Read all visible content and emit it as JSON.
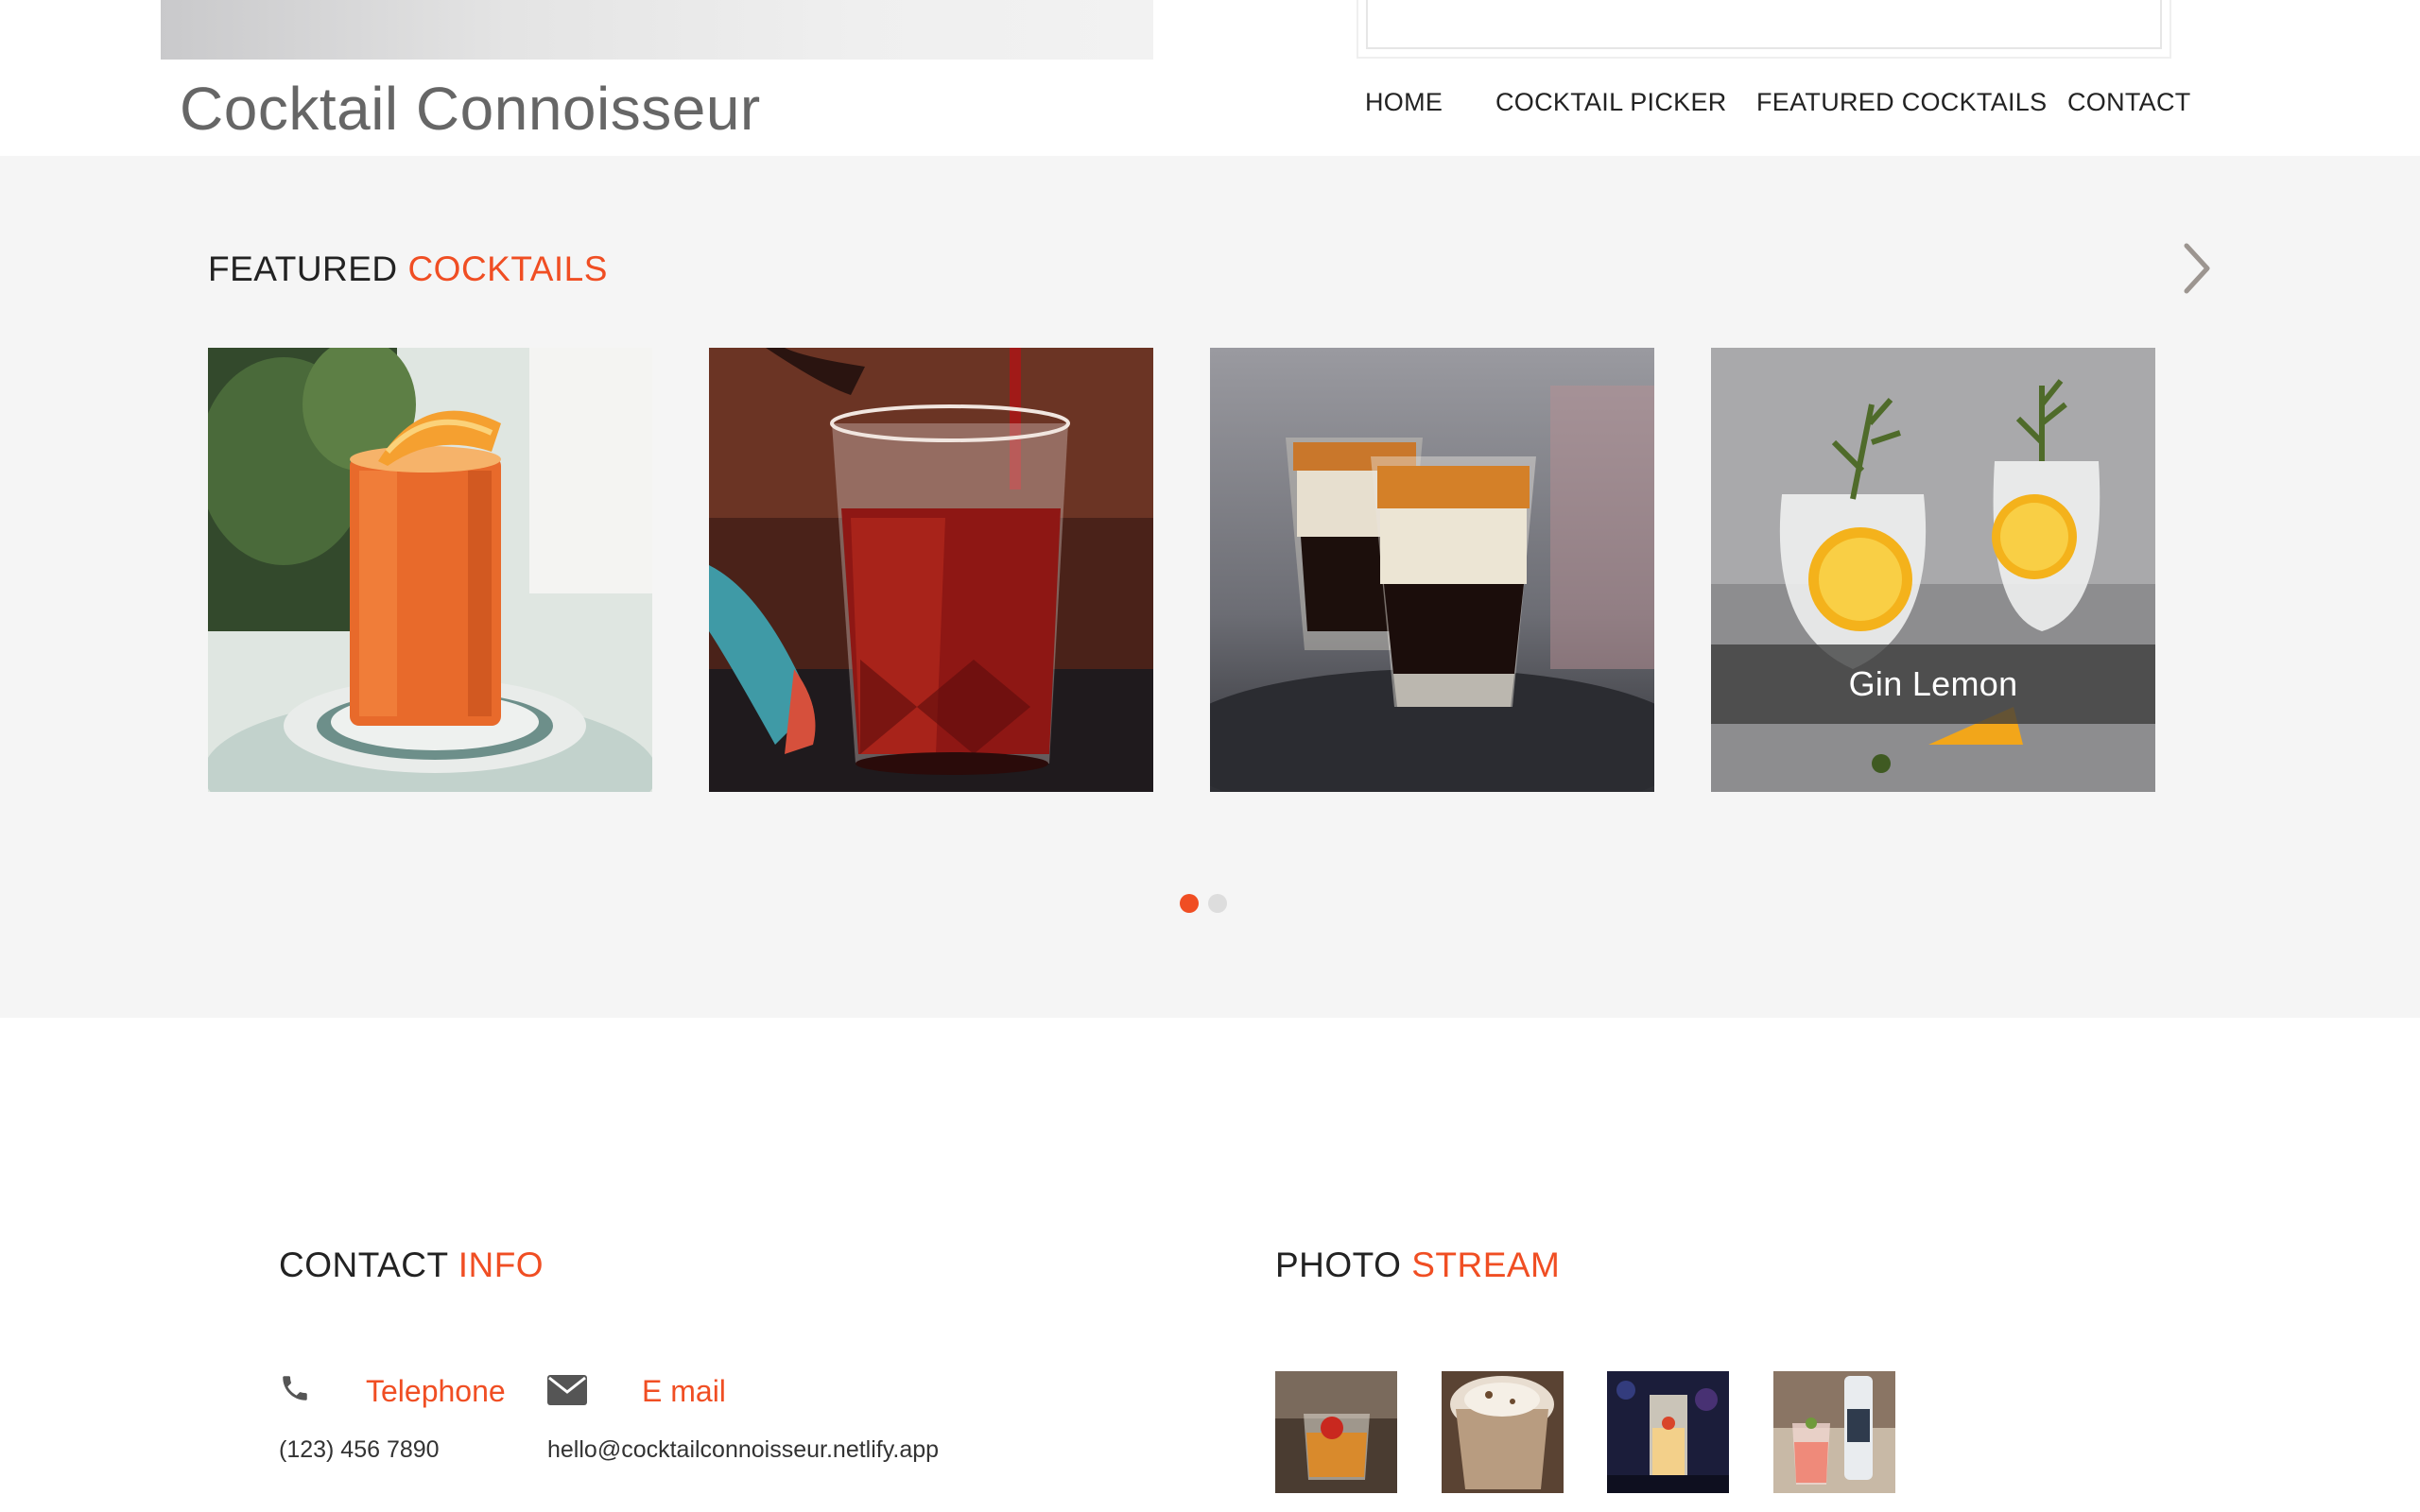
{
  "header": {
    "brand": "Cocktail Connoisseur",
    "nav": [
      {
        "label": "HOME"
      },
      {
        "label": "COCKTAIL PICKER"
      },
      {
        "label": "FEATURED COCKTAILS"
      },
      {
        "label": "CONTACT"
      }
    ]
  },
  "featured": {
    "title_main": "FEATURED",
    "title_accent": "COCKTAILS",
    "next_icon": "chevron-right-icon",
    "cards": [
      {
        "image": "orange-highball-cocktail",
        "caption": ""
      },
      {
        "image": "negroni-pour-cocktail",
        "caption": ""
      },
      {
        "image": "layered-shot-cocktail",
        "caption": ""
      },
      {
        "image": "gin-lemon-cocktail",
        "caption": "Gin Lemon"
      }
    ],
    "pagination": {
      "pages": 2,
      "active": 1
    }
  },
  "contact": {
    "title_main": "CONTACT",
    "title_accent": "INFO",
    "telephone_label": "Telephone",
    "telephone_value": "(123) 456 7890",
    "email_label": "E mail",
    "email_value": "hello@cocktailconnoisseur.netlify.app"
  },
  "photo_stream": {
    "title_main": "PHOTO",
    "title_accent": "STREAM",
    "photos": [
      "old-fashioned-photo",
      "cream-cocktail-photo",
      "bar-highball-photo",
      "pink-gin-photo"
    ]
  },
  "colors": {
    "accent": "#f04e23",
    "section_bg": "#f5f5f5",
    "dot_inactive": "#dddddd",
    "brand_text": "#666666"
  }
}
